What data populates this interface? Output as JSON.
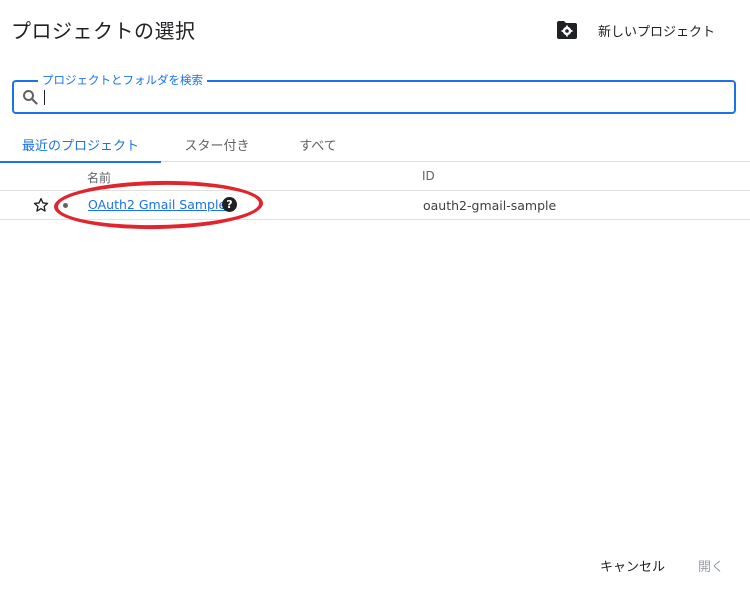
{
  "dialog": {
    "title": "プロジェクトの選択",
    "new_project_label": "新しいプロジェクト"
  },
  "search": {
    "legend": "プロジェクトとフォルダを検索",
    "value": "",
    "placeholder": ""
  },
  "tabs": [
    {
      "label": "最近のプロジェクト",
      "active": true
    },
    {
      "label": "スター付き",
      "active": false
    },
    {
      "label": "すべて",
      "active": false
    }
  ],
  "table": {
    "columns": {
      "name": "名前",
      "id": "ID"
    },
    "rows": [
      {
        "name": "OAuth2 Gmail Sample",
        "id": "oauth2-gmail-sample",
        "starred": false
      }
    ]
  },
  "footer": {
    "cancel_label": "キャンセル",
    "open_label": "開く"
  },
  "colors": {
    "accent": "#1a73e8",
    "annotation": "#e0252e",
    "disabled": "#9aa0a6"
  },
  "icons": [
    "folder-settings-icon",
    "search-icon",
    "star-outline-icon",
    "status-dot-icon",
    "help-icon"
  ]
}
